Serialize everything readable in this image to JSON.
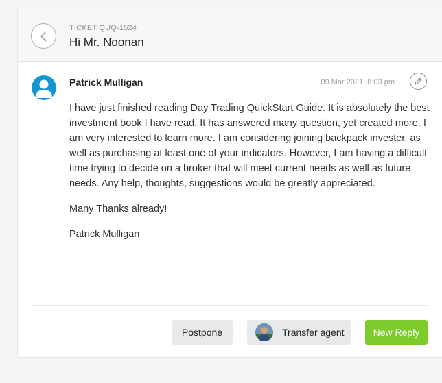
{
  "ticket": {
    "id_label": "TICKET QUQ-1524",
    "subject": "Hi Mr. Noonan"
  },
  "message": {
    "author": "Patrick Mulligan",
    "timestamp": "09 Mar 2021, 8:03 pm",
    "paragraphs": [
      "I have just finished reading Day Trading QuickStart Guide.  It is absolutely the best investment book I have read.  It has answered many question, yet created more.  I am very interested to learn more.  I am considering joining backpack invester, as well as purchasing at least one of your indicators.  However, I am having a difficult time trying to decide on a broker that will meet current needs as well as future needs.  Any help, thoughts, suggestions would be greatly appreciated.",
      "Many Thanks already!",
      "Patrick Mulligan"
    ]
  },
  "actions": {
    "postpone_label": "Postpone",
    "transfer_label": "Transfer agent",
    "reply_label": "New Reply"
  },
  "colors": {
    "accent_green": "#7ccb2b",
    "avatar_blue": "#1496d3"
  },
  "icons": {
    "back": "chevron-left-icon",
    "edit": "pencil-icon",
    "author_avatar": "user-silhouette-icon",
    "agent_avatar": "agent-photo"
  }
}
